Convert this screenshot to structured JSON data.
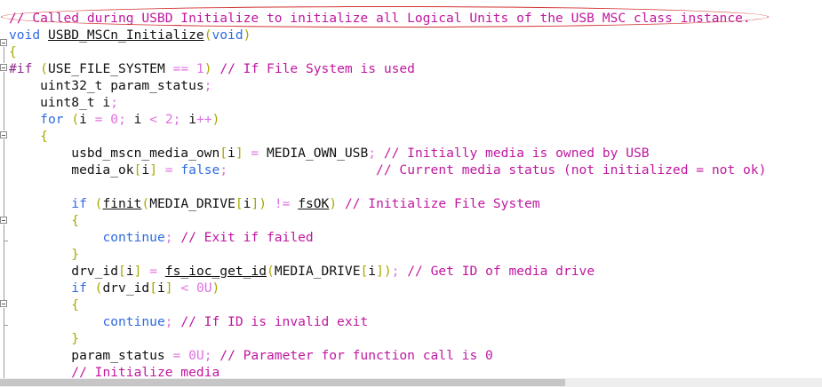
{
  "editor": {
    "lines": [
      [
        [
          "cmt",
          "// Called during USBD_Initialize to initialize all Logical Units of the USB MSC class instance."
        ]
      ],
      [
        [
          "kw",
          "void"
        ],
        [
          "id",
          " "
        ],
        [
          "idu",
          "USBD_MSCn_Initialize"
        ],
        [
          "br",
          "("
        ],
        [
          "kw",
          "void"
        ],
        [
          "br",
          ")"
        ]
      ],
      [
        [
          "br",
          "{"
        ]
      ],
      [
        [
          "pre",
          "#if "
        ],
        [
          "br",
          "("
        ],
        [
          "id",
          "USE_FILE_SYSTEM "
        ],
        [
          "op",
          "=="
        ],
        [
          "id",
          " "
        ],
        [
          "num",
          "1"
        ],
        [
          "br",
          ")"
        ],
        [
          "id",
          " "
        ],
        [
          "cmt",
          "// If File System is used"
        ]
      ],
      [
        [
          "id",
          "    uint32_t param_status"
        ],
        [
          "op",
          ";"
        ]
      ],
      [
        [
          "id",
          "    uint8_t i"
        ],
        [
          "op",
          ";"
        ]
      ],
      [
        [
          "id",
          "    "
        ],
        [
          "kw",
          "for"
        ],
        [
          "id",
          " "
        ],
        [
          "br",
          "("
        ],
        [
          "id",
          "i "
        ],
        [
          "op",
          "="
        ],
        [
          "id",
          " "
        ],
        [
          "num",
          "0"
        ],
        [
          "op",
          ";"
        ],
        [
          "id",
          " i "
        ],
        [
          "op",
          "<"
        ],
        [
          "id",
          " "
        ],
        [
          "num",
          "2"
        ],
        [
          "op",
          ";"
        ],
        [
          "id",
          " i"
        ],
        [
          "op",
          "++"
        ],
        [
          "br",
          ")"
        ]
      ],
      [
        [
          "id",
          "    "
        ],
        [
          "br",
          "{"
        ]
      ],
      [
        [
          "id",
          "        usbd_mscn_media_own"
        ],
        [
          "br",
          "["
        ],
        [
          "id",
          "i"
        ],
        [
          "br",
          "]"
        ],
        [
          "id",
          " "
        ],
        [
          "op",
          "="
        ],
        [
          "id",
          " MEDIA_OWN_USB"
        ],
        [
          "op",
          ";"
        ],
        [
          "id",
          " "
        ],
        [
          "cmt",
          "// Initially media is owned by USB"
        ]
      ],
      [
        [
          "id",
          "        media_ok"
        ],
        [
          "br",
          "["
        ],
        [
          "id",
          "i"
        ],
        [
          "br",
          "]"
        ],
        [
          "id",
          " "
        ],
        [
          "op",
          "="
        ],
        [
          "id",
          " "
        ],
        [
          "kw",
          "false"
        ],
        [
          "op",
          ";"
        ],
        [
          "id",
          "                   "
        ],
        [
          "cmt",
          "// Current media status (not initialized = not ok)"
        ]
      ],
      [],
      [
        [
          "id",
          "        "
        ],
        [
          "kw",
          "if"
        ],
        [
          "id",
          " "
        ],
        [
          "br",
          "("
        ],
        [
          "idu",
          "finit"
        ],
        [
          "br",
          "("
        ],
        [
          "id",
          "MEDIA_DRIVE"
        ],
        [
          "br",
          "["
        ],
        [
          "id",
          "i"
        ],
        [
          "br",
          "])"
        ],
        [
          "id",
          " "
        ],
        [
          "op",
          "!="
        ],
        [
          "id",
          " "
        ],
        [
          "idu",
          "fsOK"
        ],
        [
          "br",
          ")"
        ],
        [
          "id",
          " "
        ],
        [
          "cmt",
          "// Initialize File System"
        ]
      ],
      [
        [
          "id",
          "        "
        ],
        [
          "br",
          "{"
        ]
      ],
      [
        [
          "id",
          "            "
        ],
        [
          "kw",
          "continue"
        ],
        [
          "op",
          ";"
        ],
        [
          "id",
          " "
        ],
        [
          "cmt",
          "// Exit if failed"
        ]
      ],
      [
        [
          "id",
          "        "
        ],
        [
          "br",
          "}"
        ]
      ],
      [
        [
          "id",
          "        drv_id"
        ],
        [
          "br",
          "["
        ],
        [
          "id",
          "i"
        ],
        [
          "br",
          "]"
        ],
        [
          "id",
          " "
        ],
        [
          "op",
          "="
        ],
        [
          "id",
          " "
        ],
        [
          "idu",
          "fs_ioc_get_id"
        ],
        [
          "br",
          "("
        ],
        [
          "id",
          "MEDIA_DRIVE"
        ],
        [
          "br",
          "["
        ],
        [
          "id",
          "i"
        ],
        [
          "br",
          "])"
        ],
        [
          "op",
          ";"
        ],
        [
          "id",
          " "
        ],
        [
          "cmt",
          "// Get ID of media drive"
        ]
      ],
      [
        [
          "id",
          "        "
        ],
        [
          "kw",
          "if"
        ],
        [
          "id",
          " "
        ],
        [
          "br",
          "("
        ],
        [
          "id",
          "drv_id"
        ],
        [
          "br",
          "["
        ],
        [
          "id",
          "i"
        ],
        [
          "br",
          "]"
        ],
        [
          "id",
          " "
        ],
        [
          "op",
          "<"
        ],
        [
          "id",
          " "
        ],
        [
          "num",
          "0U"
        ],
        [
          "br",
          ")"
        ]
      ],
      [
        [
          "id",
          "        "
        ],
        [
          "br",
          "{"
        ]
      ],
      [
        [
          "id",
          "            "
        ],
        [
          "kw",
          "continue"
        ],
        [
          "op",
          ";"
        ],
        [
          "id",
          " "
        ],
        [
          "cmt",
          "// If ID is invalid exit"
        ]
      ],
      [
        [
          "id",
          "        "
        ],
        [
          "br",
          "}"
        ]
      ],
      [
        [
          "id",
          "        param_status "
        ],
        [
          "op",
          "="
        ],
        [
          "id",
          " "
        ],
        [
          "num",
          "0U"
        ],
        [
          "op",
          ";"
        ],
        [
          "id",
          " "
        ],
        [
          "cmt",
          "// Parameter for function call is 0"
        ]
      ],
      [
        [
          "id",
          "        "
        ],
        [
          "cmt",
          "// Initialize media"
        ]
      ]
    ],
    "colors": {
      "comment": "#c0189f",
      "keyword": "#2f6be0",
      "number": "#e070e0",
      "operator": "#e070e0",
      "bracket": "#a8a800",
      "preprocessor": "#8a2a8a",
      "identifier": "#111111",
      "annotation": "#d23030"
    }
  }
}
